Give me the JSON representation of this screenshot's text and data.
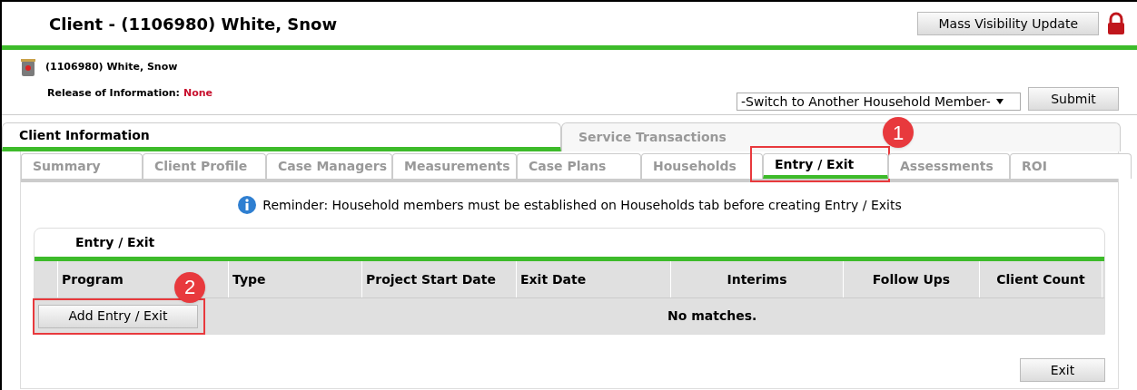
{
  "header": {
    "title": "Client - (1106980) White, Snow",
    "button": "Mass Visibility Update"
  },
  "client": {
    "name": "(1106980) White, Snow",
    "roi_label": "Release of Information:",
    "roi_value": "None",
    "member_select": "-Switch to Another Household Member-",
    "submit": "Submit"
  },
  "main_tabs": [
    {
      "label": "Client Information",
      "selected": true
    },
    {
      "label": "Service Transactions",
      "selected": false
    }
  ],
  "sub_tabs": [
    {
      "label": "Summary",
      "selected": false
    },
    {
      "label": "Client Profile",
      "selected": false
    },
    {
      "label": "Case Managers",
      "selected": false
    },
    {
      "label": "Measurements",
      "selected": false
    },
    {
      "label": "Case Plans",
      "selected": false
    },
    {
      "label": "Households",
      "selected": false
    },
    {
      "label": "Entry / Exit",
      "selected": true,
      "callout": "1"
    },
    {
      "label": "Assessments",
      "selected": false
    },
    {
      "label": "ROI",
      "selected": false
    }
  ],
  "reminder": "Reminder: Household members must be established on Households tab before creating Entry / Exits",
  "panel": {
    "title": "Entry / Exit",
    "columns": [
      "Program",
      "Type",
      "Project Start Date",
      "Exit Date",
      "Interims",
      "Follow Ups",
      "Client Count"
    ],
    "add_button": "Add Entry / Exit",
    "add_callout": "2",
    "empty": "No matches."
  },
  "exit_button": "Exit"
}
